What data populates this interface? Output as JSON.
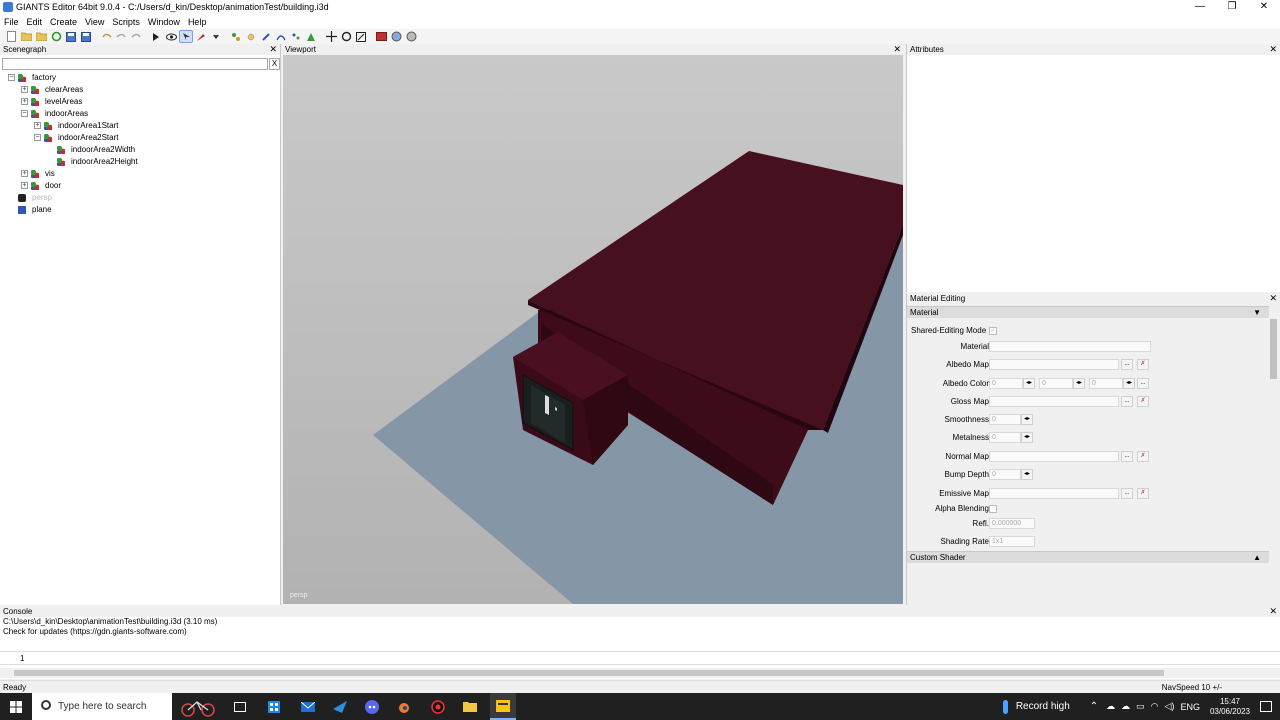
{
  "window": {
    "title": "GIANTS Editor 64bit 9.0.4 - C:/Users/d_kin/Desktop/animationTest/building.i3d",
    "minimize": "—",
    "maximize": "❐",
    "close": "✕"
  },
  "menu": [
    "File",
    "Edit",
    "Create",
    "View",
    "Scripts",
    "Window",
    "Help"
  ],
  "scenegraph": {
    "title": "Scenegraph",
    "close": "✕",
    "search_placeholder": "",
    "clear": "X",
    "nodes": [
      {
        "label": "factory",
        "expander": "−",
        "icon": "transform-group-icon",
        "depth": 0,
        "muted": false
      },
      {
        "label": "clearAreas",
        "expander": "+",
        "icon": "transform-group-icon",
        "depth": 1,
        "muted": false
      },
      {
        "label": "levelAreas",
        "expander": "+",
        "icon": "transform-group-icon",
        "depth": 1,
        "muted": false
      },
      {
        "label": "indoorAreas",
        "expander": "−",
        "icon": "transform-group-icon",
        "depth": 1,
        "muted": false
      },
      {
        "label": "indoorArea1Start",
        "expander": "+",
        "icon": "transform-group-icon",
        "depth": 2,
        "muted": false
      },
      {
        "label": "indoorArea2Start",
        "expander": "−",
        "icon": "transform-group-icon",
        "depth": 2,
        "muted": false
      },
      {
        "label": "indoorArea2Width",
        "expander": "",
        "icon": "transform-group-icon",
        "depth": 3,
        "muted": false
      },
      {
        "label": "indoorArea2Height",
        "expander": "",
        "icon": "transform-group-icon",
        "depth": 3,
        "muted": false
      },
      {
        "label": "vis",
        "expander": "+",
        "icon": "transform-group-icon",
        "depth": 1,
        "muted": false
      },
      {
        "label": "door",
        "expander": "+",
        "icon": "transform-group-icon",
        "depth": 1,
        "muted": false
      },
      {
        "label": "persp",
        "expander": "",
        "icon": "camera-icon",
        "depth": 0,
        "muted": true
      },
      {
        "label": "plane",
        "expander": "",
        "icon": "shape-icon",
        "depth": 0,
        "muted": false
      }
    ]
  },
  "viewport": {
    "title": "Viewport",
    "close": "✕",
    "camera_label": "persp"
  },
  "attributes": {
    "title": "Attributes",
    "close": "✕"
  },
  "material_editing": {
    "title": "Material Editing",
    "close": "✕",
    "section_material": "Material",
    "section_material_arrow": "▼",
    "shared_editing_mode": "Shared-Editing Mode",
    "shared_editing_check": "✓",
    "material_label": "Material",
    "albedo_map": "Albedo Map",
    "albedo_color": "Albedo Color",
    "albedo_values": [
      "0",
      "0",
      "0"
    ],
    "gloss_map": "Gloss Map",
    "smoothness": "Smoothness",
    "smoothness_value": "0",
    "metalness": "Metalness",
    "metalness_value": "0",
    "normal_map": "Normal Map",
    "bump_depth": "Bump Depth",
    "bump_depth_value": "0",
    "emissive_map": "Emissive Map",
    "alpha_blending": "Alpha Blending",
    "refl": "Refl.",
    "refl_value": "0.000000",
    "shading_rate": "Shading Rate",
    "shading_rate_value": "1x1",
    "browse": "...",
    "clear_map": "✗",
    "spin": "◂▸",
    "section_custom_shader": "Custom Shader",
    "section_custom_shader_arrow": "▲"
  },
  "console": {
    "title": "Console",
    "close": "✕",
    "lines": [
      "C:\\Users\\d_kin\\Desktop\\animationTest\\building.i3d (3.10 ms)",
      "Check for updates (https://gdn.giants-software.com)"
    ],
    "input_line_number": "1"
  },
  "status": {
    "left": "Ready",
    "right": "NavSpeed 10 +/-"
  },
  "taskbar": {
    "search_placeholder": "Type here to search",
    "weather": "Record high",
    "language": "ENG",
    "time": "15:47",
    "date": "03/06/2023"
  }
}
